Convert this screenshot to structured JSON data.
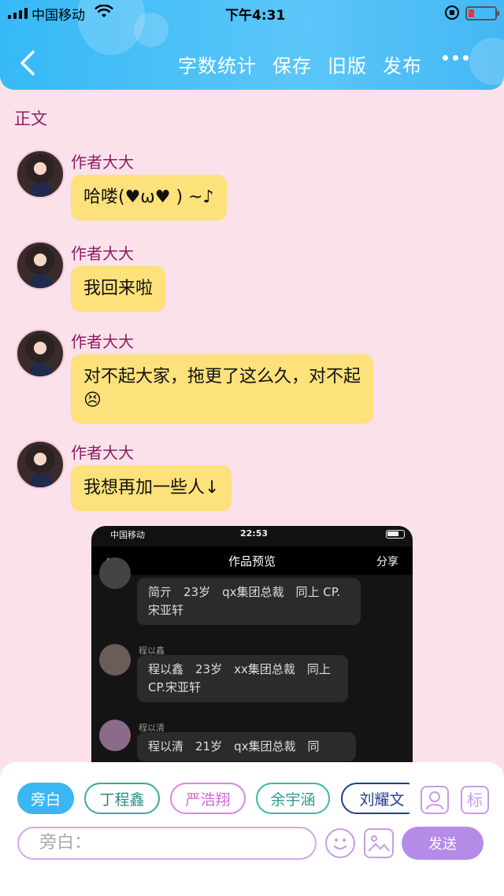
{
  "status_bar": {
    "carrier": "中国移动",
    "time": "下午4:31"
  },
  "toolbar": {
    "word_count": "字数统计",
    "save": "保存",
    "old_version": "旧版",
    "publish": "发布"
  },
  "section_label": "正文",
  "messages": [
    {
      "author": "作者大大",
      "text": "哈喽(♥ω♥ ) ~♪"
    },
    {
      "author": "作者大大",
      "text": "我回来啦"
    },
    {
      "author": "作者大大",
      "text": "对不起大家，拖更了这么久，对不起😣"
    },
    {
      "author": "作者大大",
      "text": "我想再加一些人↓"
    }
  ],
  "embedded_screenshot": {
    "carrier": "中国移动",
    "time": "22:53",
    "title": "作品预览",
    "share": "分享",
    "entries": [
      {
        "name": "",
        "text": "简亓　23岁　qx集团总裁　同上 CP.宋亚轩"
      },
      {
        "name": "程以鑫",
        "text": "程以鑫　23岁　xx集团总裁　同上　CP.宋亚轩"
      },
      {
        "name": "程以清",
        "text": "程以清　21岁　qx集团总裁　同"
      }
    ]
  },
  "roles": [
    "旁白",
    "丁程鑫",
    "严浩翔",
    "余宇涵",
    "刘耀文"
  ],
  "role_colors": {
    "active": "#3ab7f2",
    "ding": "#3aa7a0",
    "yan": "#e083e0",
    "yu": "#3db7a8",
    "liu": "#1d3f8a"
  },
  "tools": {
    "label_button": "标"
  },
  "input": {
    "placeholder": "旁白："
  },
  "send_label": "发送"
}
